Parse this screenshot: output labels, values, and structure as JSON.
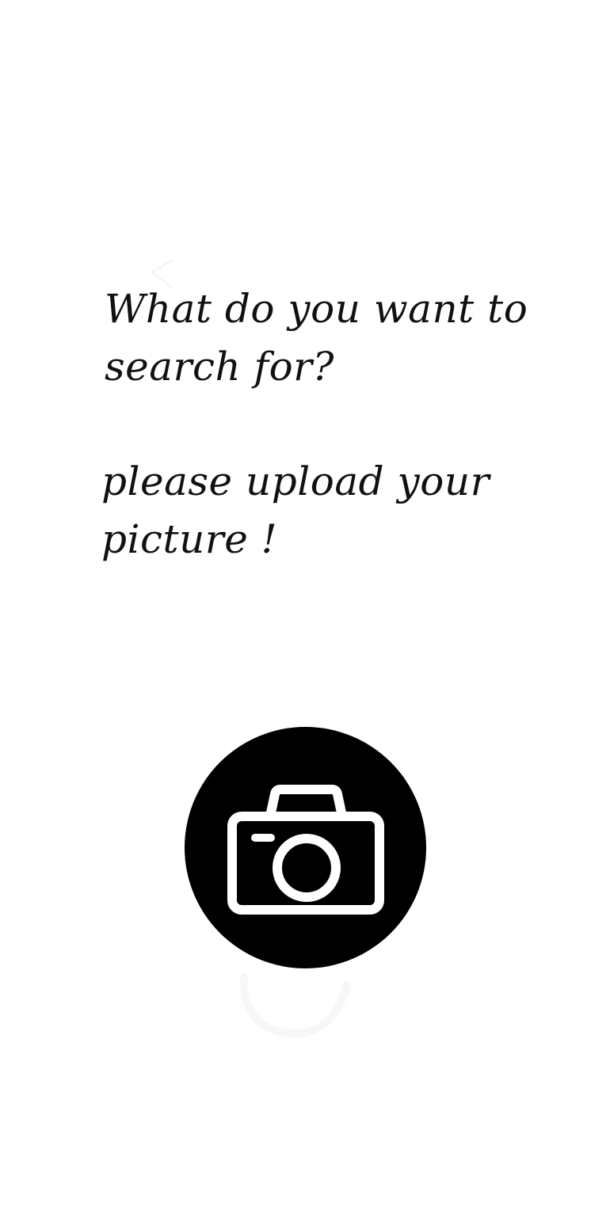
{
  "prompt": {
    "line1": "What do you want to",
    "line2": "search for?"
  },
  "instruction": {
    "line1": "please upload your",
    "line2": "picture !"
  },
  "upload": {
    "icon": "camera-icon"
  },
  "colors": {
    "background": "#ffffff",
    "text": "#111111",
    "button": "#000000",
    "icon": "#ffffff"
  }
}
